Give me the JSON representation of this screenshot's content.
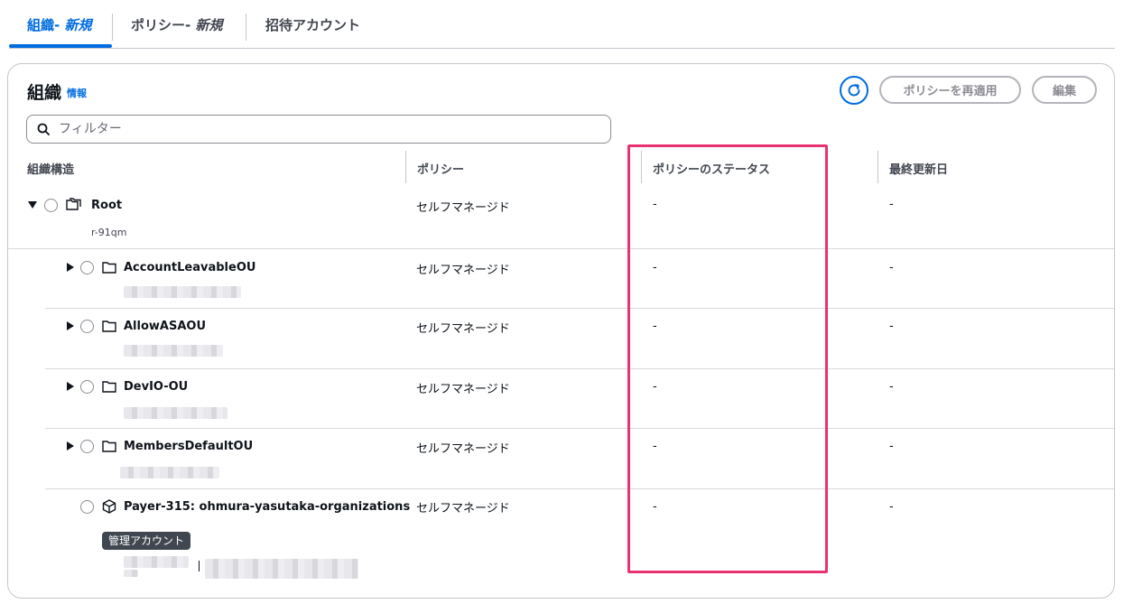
{
  "tabs": [
    {
      "label": "組織- ",
      "suffix": "新規"
    },
    {
      "label": "ポリシー- ",
      "suffix": "新規"
    },
    {
      "label": "招待アカウント"
    }
  ],
  "panel": {
    "title": "組織",
    "info_link": "情報",
    "reapply_button": "ポリシーを再適用",
    "edit_button": "編集",
    "filter_placeholder": "フィルター"
  },
  "table": {
    "headers": [
      "組織構造",
      "ポリシー",
      "ポリシーのステータス",
      "最終更新日"
    ],
    "root": {
      "name": "Root",
      "id": "r-91qm",
      "policy": "セルフマネージド",
      "status": "-",
      "updated": "-"
    },
    "rows": [
      {
        "name": "AccountLeavableOU",
        "policy": "セルフマネージド",
        "status": "-",
        "updated": "-"
      },
      {
        "name": "AllowASAOU",
        "policy": "セルフマネージド",
        "status": "-",
        "updated": "-"
      },
      {
        "name": "DevIO-OU",
        "policy": "セルフマネージド",
        "status": "-",
        "updated": "-"
      },
      {
        "name": "MembersDefaultOU",
        "policy": "セルフマネージド",
        "status": "-",
        "updated": "-"
      }
    ],
    "account": {
      "name": "Payer-315: ohmura-yasutaka-organizations",
      "badge": "管理アカウント",
      "policy": "セルフマネージド",
      "status": "-",
      "updated": "-"
    }
  },
  "colors": {
    "accent": "#006ce0",
    "highlight": "#e8336f",
    "badge_bg": "#414750"
  }
}
